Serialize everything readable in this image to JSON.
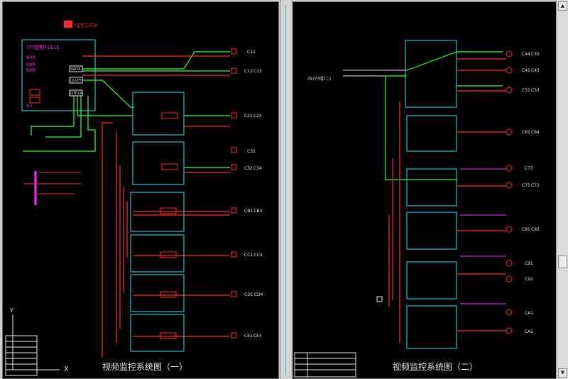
{
  "left_sheet": {
    "title": "视频监控系统图（一）",
    "top_box_label": "???控制?1111",
    "top_tag": "?监控工作站",
    "axis_x": "X",
    "axis_y": "Y",
    "devices": [
      "NVR",
      "DVR",
      "DVR",
      "SW26",
      "LIU-FT",
      "DTF24"
    ],
    "outputs": [
      "C11",
      "C12 C13",
      "C21 C24",
      "C31",
      "C32 C34",
      "CB1 CB3",
      "CC1 CC4",
      "CD1 CD4",
      "CE1 CE4"
    ]
  },
  "right_sheet": {
    "title": "视频监控系统图（二）",
    "left_label": "?9???楼(二)",
    "outputs": [
      "C44 C55",
      "C41 C43",
      "C51 C53",
      "C61 C64",
      "C73",
      "C71 C72",
      "C81 C83",
      "C91",
      "C92",
      "CA1",
      "CA2"
    ]
  },
  "colors": {
    "red": "#ff2b2b",
    "green": "#37ff37",
    "cyan": "#2ee6e6",
    "magenta": "#ff2bff",
    "white": "#e8e8e8",
    "yellow": "#ffff3a",
    "bg": "#000000"
  }
}
